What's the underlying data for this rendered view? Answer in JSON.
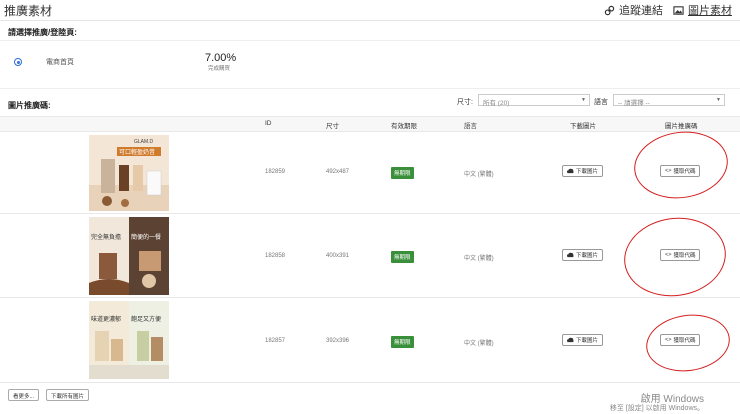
{
  "header": {
    "title": "推廣素材",
    "links": [
      {
        "label": "追蹤連結",
        "icon": "link-icon"
      },
      {
        "label": "圖片素材",
        "icon": "image-icon"
      }
    ]
  },
  "landing": {
    "label": "請選擇推廣/登陸頁:",
    "option": "電商首頁",
    "rate": "7.00%",
    "rate_sub": "完成購買"
  },
  "filters": {
    "section_label": "圖片推廣碼:",
    "size_label": "尺寸:",
    "size_value": "所有 (20)",
    "lang_label": "語言",
    "lang_placeholder": "-- 請選擇 --"
  },
  "table": {
    "headers": [
      "ID",
      "尺寸",
      "有效期限",
      "語言",
      "下載圖片",
      "圖片推廣碼"
    ],
    "rows": [
      {
        "id": "182859",
        "size": "492x487",
        "expiry": "無期限",
        "lang": "中文 (繁體)",
        "download": "下載圖片",
        "code": "獲取代碼"
      },
      {
        "id": "182858",
        "size": "400x391",
        "expiry": "無期限",
        "lang": "中文 (繁體)",
        "download": "下載圖片",
        "code": "獲取代碼"
      },
      {
        "id": "182857",
        "size": "392x396",
        "expiry": "無期限",
        "lang": "中文 (繁體)",
        "download": "下載圖片",
        "code": "獲取代碼"
      }
    ]
  },
  "thumbs": {
    "t1_headline": "可口輕盈奶昔",
    "t1_brand": "GLAM.D",
    "t2_left": "完全無負擔",
    "t2_right": "簡便的一餐",
    "t3_left": "味道更濃郁",
    "t3_right": "飽足又方便"
  },
  "footer": {
    "more": "看更多...",
    "download_all": "下載所有圖片"
  },
  "watermark": {
    "line1": "啟用 Windows",
    "line2": "移至 [設定] 以啟用 Windows。"
  }
}
